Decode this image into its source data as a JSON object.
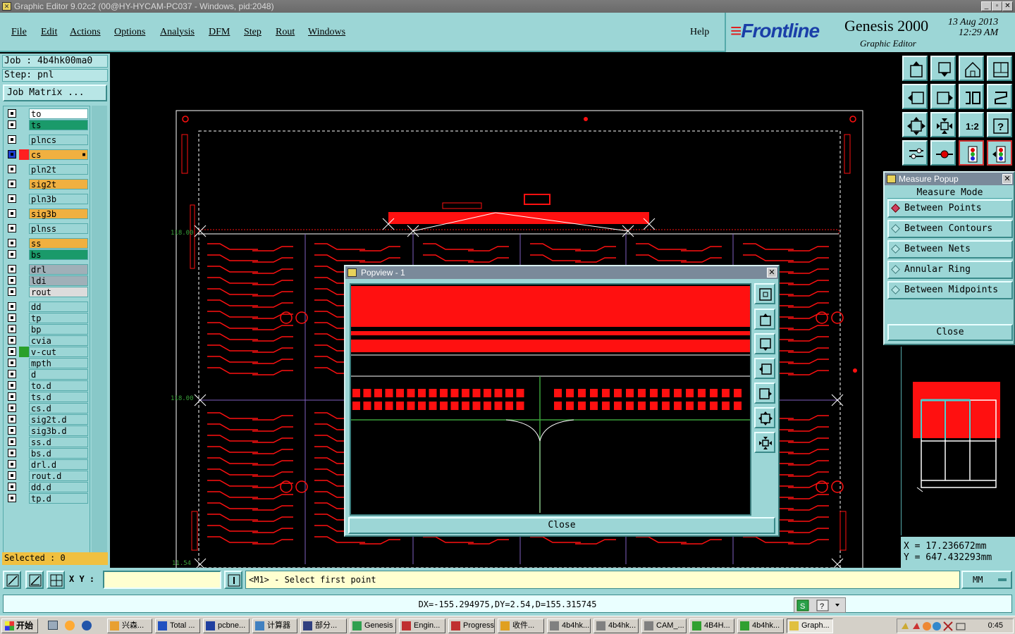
{
  "window": {
    "title": "Graphic Editor 9.02c2 (00@HY-HYCAM-PC037 - Windows, pid:2048)",
    "min_label": "_",
    "max_label": "▫",
    "close_label": "✕"
  },
  "menu": {
    "items": [
      "File",
      "Edit",
      "Actions",
      "Options",
      "Analysis",
      "DFM",
      "Step",
      "Rout",
      "Windows"
    ],
    "help": "Help"
  },
  "logo": {
    "brand": "Frontline",
    "product": "Genesis 2000",
    "subtitle": "Graphic Editor",
    "date": "13 Aug 2013",
    "time": "12:29 AM"
  },
  "job": {
    "job_label": "Job : 4b4hk00ma0",
    "step_label": "Step: pnl",
    "matrix_button": "Job Matrix ..."
  },
  "layers": [
    {
      "name": "to",
      "color": "#ffffff",
      "swatch": ""
    },
    {
      "name": "ts",
      "color": "#1a9a6a",
      "swatch": ""
    },
    {
      "name": "plncs",
      "color": "#9cd6d6",
      "swatch": ""
    },
    {
      "name": "cs",
      "color": "#f0b040",
      "swatch": "#ff2020",
      "marker": "▪"
    },
    {
      "name": "pln2t",
      "color": "#9cd6d6",
      "swatch": ""
    },
    {
      "name": "sig2t",
      "color": "#f0b040",
      "swatch": ""
    },
    {
      "name": "pln3b",
      "color": "#9cd6d6",
      "swatch": ""
    },
    {
      "name": "sig3b",
      "color": "#f0b040",
      "swatch": ""
    },
    {
      "name": "plnss",
      "color": "#9cd6d6",
      "swatch": ""
    },
    {
      "name": "ss",
      "color": "#f0b040",
      "swatch": ""
    },
    {
      "name": "bs",
      "color": "#1a9a6a",
      "swatch": ""
    },
    {
      "name": "drl",
      "color": "#a0b0b8",
      "swatch": ""
    },
    {
      "name": "ldi",
      "color": "#a0b0b8",
      "swatch": ""
    },
    {
      "name": "rout",
      "color": "#dcdcdc",
      "swatch": ""
    },
    {
      "name": "dd",
      "color": "#9cd6d6",
      "swatch": ""
    },
    {
      "name": "tp",
      "color": "#9cd6d6",
      "swatch": ""
    },
    {
      "name": "bp",
      "color": "#9cd6d6",
      "swatch": ""
    },
    {
      "name": "cvia",
      "color": "#9cd6d6",
      "swatch": ""
    },
    {
      "name": "v-cut",
      "color": "#9cd6d6",
      "swatch": "#2aa02a"
    },
    {
      "name": "mpth",
      "color": "#9cd6d6",
      "swatch": ""
    },
    {
      "name": "d",
      "color": "#9cd6d6",
      "swatch": ""
    },
    {
      "name": "to.d",
      "color": "#9cd6d6",
      "swatch": ""
    },
    {
      "name": "ts.d",
      "color": "#9cd6d6",
      "swatch": ""
    },
    {
      "name": "cs.d",
      "color": "#9cd6d6",
      "swatch": ""
    },
    {
      "name": "sig2t.d",
      "color": "#9cd6d6",
      "swatch": ""
    },
    {
      "name": "sig3b.d",
      "color": "#9cd6d6",
      "swatch": ""
    },
    {
      "name": "ss.d",
      "color": "#9cd6d6",
      "swatch": ""
    },
    {
      "name": "bs.d",
      "color": "#9cd6d6",
      "swatch": ""
    },
    {
      "name": "drl.d",
      "color": "#9cd6d6",
      "swatch": ""
    },
    {
      "name": "rout.d",
      "color": "#9cd6d6",
      "swatch": ""
    },
    {
      "name": "dd.d",
      "color": "#9cd6d6",
      "swatch": ""
    },
    {
      "name": "tp.d",
      "color": "#9cd6d6",
      "swatch": ""
    }
  ],
  "selected": "Selected : 0",
  "canvas": {
    "labels": {
      "top_left": "118.00",
      "mid_left": "118.00",
      "bottom_left": "11.54"
    }
  },
  "measure_popup": {
    "title": "Measure Popup",
    "mode_label": "Measure Mode",
    "options": [
      "Between Points",
      "Between Contours",
      "Between Nets",
      "Annular Ring",
      "Between Midpoints"
    ],
    "selected": "Between Points",
    "close": "Close"
  },
  "popview": {
    "title": "Popview - 1",
    "close": "Close"
  },
  "coords": {
    "x": "X = 17.236672mm",
    "y": "Y = 647.432293mm"
  },
  "statusbar": {
    "xy_label": "X Y :",
    "xy_value": "",
    "prompt": "<M1> - Select first point",
    "units": "MM"
  },
  "message": "DX=-155.294975,DY=2.54,D=155.315745",
  "taskbar": {
    "start": "开始",
    "tasks": [
      "兴森...",
      "Total ...",
      "pcbne...",
      "计算器",
      "部分...",
      "Genesis",
      "Engin...",
      "Progress",
      "收件...",
      "4b4hk...",
      "4b4hk...",
      "CAM_...",
      "4B4H...",
      "4b4hk...",
      "Graph..."
    ],
    "active": "Graph...",
    "clock": "0:45"
  },
  "colors": {
    "panel": "#9cd6d6",
    "copper": "#ff1010",
    "outline": "#ffffff",
    "vcut": "#3aa03a"
  }
}
